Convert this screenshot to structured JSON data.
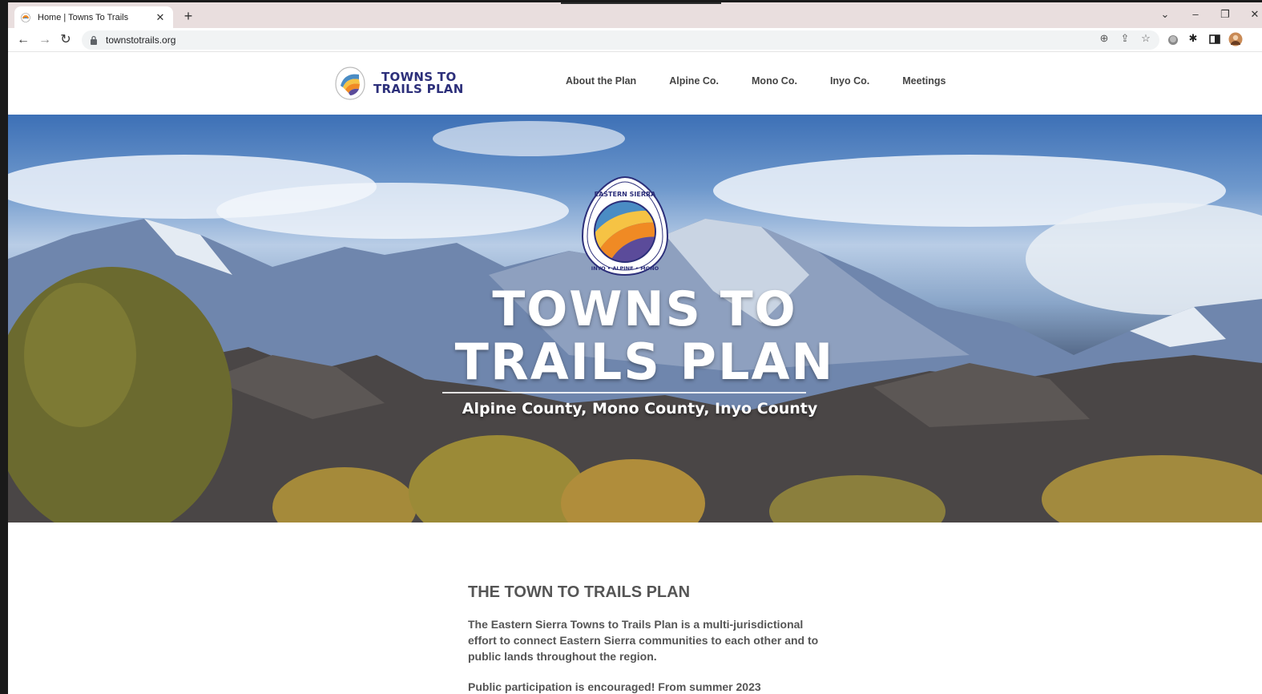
{
  "browser": {
    "tab_title": "Home | Towns To Trails",
    "new_tab": "+",
    "url": "townstotrails.org"
  },
  "site": {
    "logo": {
      "line1": "TOWNS TO",
      "line2": "TRAILS PLAN"
    },
    "nav": [
      {
        "label": "About the Plan"
      },
      {
        "label": "Alpine Co."
      },
      {
        "label": "Mono Co."
      },
      {
        "label": "Inyo Co."
      },
      {
        "label": "Meetings"
      }
    ]
  },
  "hero": {
    "badge_top": "EASTERN SIERRA",
    "badge_bottom": "INYO • ALPINE • MONO",
    "title_line1": "TOWNS TO",
    "title_line2": "TRAILS PLAN",
    "subtitle": "Alpine County, Mono County, Inyo County"
  },
  "content": {
    "heading": "THE TOWN TO TRAILS PLAN",
    "paragraph1": "The Eastern Sierra Towns to Trails Plan is a multi-jurisdictional effort to connect Eastern Sierra communities to each other and to public lands throughout the region.",
    "paragraph2": "Public participation is encouraged!  From summer 2023"
  },
  "colors": {
    "brand_navy": "#2c2f7a",
    "nav_text": "#444444",
    "badge_orange": "#f08a24",
    "badge_yellow": "#f6c344",
    "badge_blue": "#4a8cc4",
    "badge_purple": "#5b4b9a"
  }
}
